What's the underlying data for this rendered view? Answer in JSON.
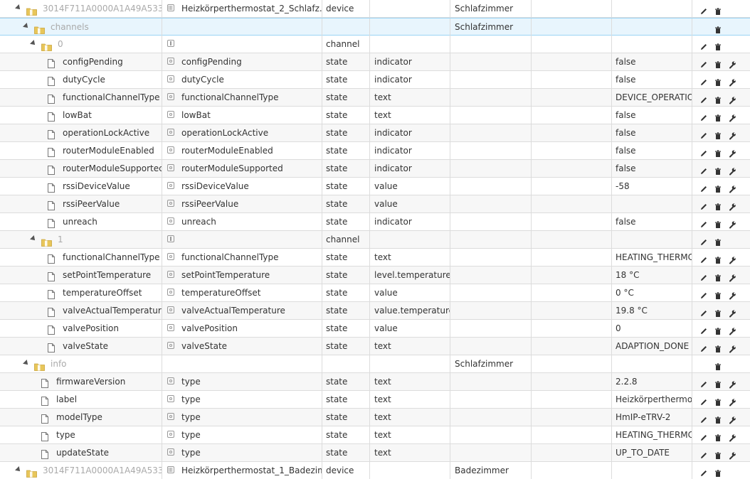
{
  "colors": {
    "folder": "#e8c65a",
    "selected_bg": "#e8f5fd",
    "stripe": "#f7f7f7",
    "grid": "#dcdcdc"
  },
  "icons": {
    "edit": "pencil-icon",
    "delete": "trash-icon",
    "settings": "wrench-icon",
    "folder": "folder-icon",
    "state": "file-icon"
  },
  "rows": [
    {
      "kind": "device",
      "level": 0,
      "id": "3014F711A0000A1A49A533D",
      "name": "Heizkörperthermostat_2_Schlafz...",
      "type": "device",
      "role": "",
      "room": "Schlafzimmer",
      "value": "",
      "buttons": [
        "edit",
        "delete"
      ]
    },
    {
      "kind": "folder",
      "level": 1,
      "id": "channels",
      "name": "",
      "type": "",
      "role": "",
      "room": "Schlafzimmer",
      "value": "",
      "buttons": [
        "delete"
      ],
      "selected": true
    },
    {
      "kind": "channel",
      "level": 2,
      "id": "0",
      "name": "",
      "type": "channel",
      "role": "",
      "room": "",
      "value": "",
      "buttons": [
        "edit",
        "delete"
      ]
    },
    {
      "kind": "state",
      "level": 3,
      "id": "configPending",
      "name": "configPending",
      "type": "state",
      "role": "indicator",
      "room": "",
      "value": "false",
      "buttons": [
        "edit",
        "delete",
        "settings"
      ]
    },
    {
      "kind": "state",
      "level": 3,
      "id": "dutyCycle",
      "name": "dutyCycle",
      "type": "state",
      "role": "indicator",
      "room": "",
      "value": "false",
      "buttons": [
        "edit",
        "delete",
        "settings"
      ]
    },
    {
      "kind": "state",
      "level": 3,
      "id": "functionalChannelType",
      "name": "functionalChannelType",
      "type": "state",
      "role": "text",
      "room": "",
      "value": "DEVICE_OPERATIO",
      "buttons": [
        "edit",
        "delete",
        "settings"
      ]
    },
    {
      "kind": "state",
      "level": 3,
      "id": "lowBat",
      "name": "lowBat",
      "type": "state",
      "role": "text",
      "room": "",
      "value": "false",
      "buttons": [
        "edit",
        "delete",
        "settings"
      ]
    },
    {
      "kind": "state",
      "level": 3,
      "id": "operationLockActive",
      "name": "operationLockActive",
      "type": "state",
      "role": "indicator",
      "room": "",
      "value": "false",
      "buttons": [
        "edit",
        "delete",
        "settings"
      ]
    },
    {
      "kind": "state",
      "level": 3,
      "id": "routerModuleEnabled",
      "name": "routerModuleEnabled",
      "type": "state",
      "role": "indicator",
      "room": "",
      "value": "false",
      "buttons": [
        "edit",
        "delete",
        "settings"
      ]
    },
    {
      "kind": "state",
      "level": 3,
      "id": "routerModuleSupportec",
      "name": "routerModuleSupported",
      "type": "state",
      "role": "indicator",
      "room": "",
      "value": "false",
      "buttons": [
        "edit",
        "delete",
        "settings"
      ]
    },
    {
      "kind": "state",
      "level": 3,
      "id": "rssiDeviceValue",
      "name": "rssiDeviceValue",
      "type": "state",
      "role": "value",
      "room": "",
      "value": "-58",
      "buttons": [
        "edit",
        "delete",
        "settings"
      ]
    },
    {
      "kind": "state",
      "level": 3,
      "id": "rssiPeerValue",
      "name": "rssiPeerValue",
      "type": "state",
      "role": "value",
      "room": "",
      "value": "",
      "buttons": [
        "edit",
        "delete",
        "settings"
      ]
    },
    {
      "kind": "state",
      "level": 3,
      "id": "unreach",
      "name": "unreach",
      "type": "state",
      "role": "indicator",
      "room": "",
      "value": "false",
      "buttons": [
        "edit",
        "delete",
        "settings"
      ]
    },
    {
      "kind": "channel",
      "level": 2,
      "id": "1",
      "name": "",
      "type": "channel",
      "role": "",
      "room": "",
      "value": "",
      "buttons": [
        "edit",
        "delete"
      ]
    },
    {
      "kind": "state",
      "level": 3,
      "id": "functionalChannelType",
      "name": "functionalChannelType",
      "type": "state",
      "role": "text",
      "room": "",
      "value": "HEATING_THERMC",
      "buttons": [
        "edit",
        "delete",
        "settings"
      ]
    },
    {
      "kind": "state",
      "level": 3,
      "id": "setPointTemperature",
      "name": "setPointTemperature",
      "type": "state",
      "role": "level.temperature",
      "room": "",
      "value": "18 °C",
      "buttons": [
        "edit",
        "delete",
        "settings"
      ]
    },
    {
      "kind": "state",
      "level": 3,
      "id": "temperatureOffset",
      "name": "temperatureOffset",
      "type": "state",
      "role": "value",
      "room": "",
      "value": "0 °C",
      "buttons": [
        "edit",
        "delete",
        "settings"
      ]
    },
    {
      "kind": "state",
      "level": 3,
      "id": "valveActualTemperature",
      "name": "valveActualTemperature",
      "type": "state",
      "role": "value.temperature",
      "room": "",
      "value": "19.8 °C",
      "buttons": [
        "edit",
        "delete",
        "settings"
      ]
    },
    {
      "kind": "state",
      "level": 3,
      "id": "valvePosition",
      "name": "valvePosition",
      "type": "state",
      "role": "value",
      "room": "",
      "value": "0",
      "buttons": [
        "edit",
        "delete",
        "settings"
      ]
    },
    {
      "kind": "state",
      "level": 3,
      "id": "valveState",
      "name": "valveState",
      "type": "state",
      "role": "text",
      "room": "",
      "value": "ADAPTION_DONE",
      "buttons": [
        "edit",
        "delete",
        "settings"
      ]
    },
    {
      "kind": "folder",
      "level": 1,
      "id": "info",
      "name": "",
      "type": "",
      "role": "",
      "room": "Schlafzimmer",
      "value": "",
      "buttons": [
        "delete"
      ]
    },
    {
      "kind": "state",
      "level": 2,
      "id": "firmwareVersion",
      "name": "type",
      "type": "state",
      "role": "text",
      "room": "",
      "value": "2.2.8",
      "buttons": [
        "edit",
        "delete",
        "settings"
      ]
    },
    {
      "kind": "state",
      "level": 2,
      "id": "label",
      "name": "type",
      "type": "state",
      "role": "text",
      "room": "",
      "value": "Heizkörperthermos",
      "buttons": [
        "edit",
        "delete",
        "settings"
      ]
    },
    {
      "kind": "state",
      "level": 2,
      "id": "modelType",
      "name": "type",
      "type": "state",
      "role": "text",
      "room": "",
      "value": "HmIP-eTRV-2",
      "buttons": [
        "edit",
        "delete",
        "settings"
      ]
    },
    {
      "kind": "state",
      "level": 2,
      "id": "type",
      "name": "type",
      "type": "state",
      "role": "text",
      "room": "",
      "value": "HEATING_THERMC",
      "buttons": [
        "edit",
        "delete",
        "settings"
      ]
    },
    {
      "kind": "state",
      "level": 2,
      "id": "updateState",
      "name": "type",
      "type": "state",
      "role": "text",
      "room": "",
      "value": "UP_TO_DATE",
      "buttons": [
        "edit",
        "delete",
        "settings"
      ]
    },
    {
      "kind": "device",
      "level": 0,
      "id": "3014F711A0000A1A49A533D",
      "name": "Heizkörperthermostat_1_Badezim",
      "type": "device",
      "role": "",
      "room": "Badezimmer",
      "value": "",
      "buttons": [
        "edit",
        "delete"
      ]
    }
  ]
}
